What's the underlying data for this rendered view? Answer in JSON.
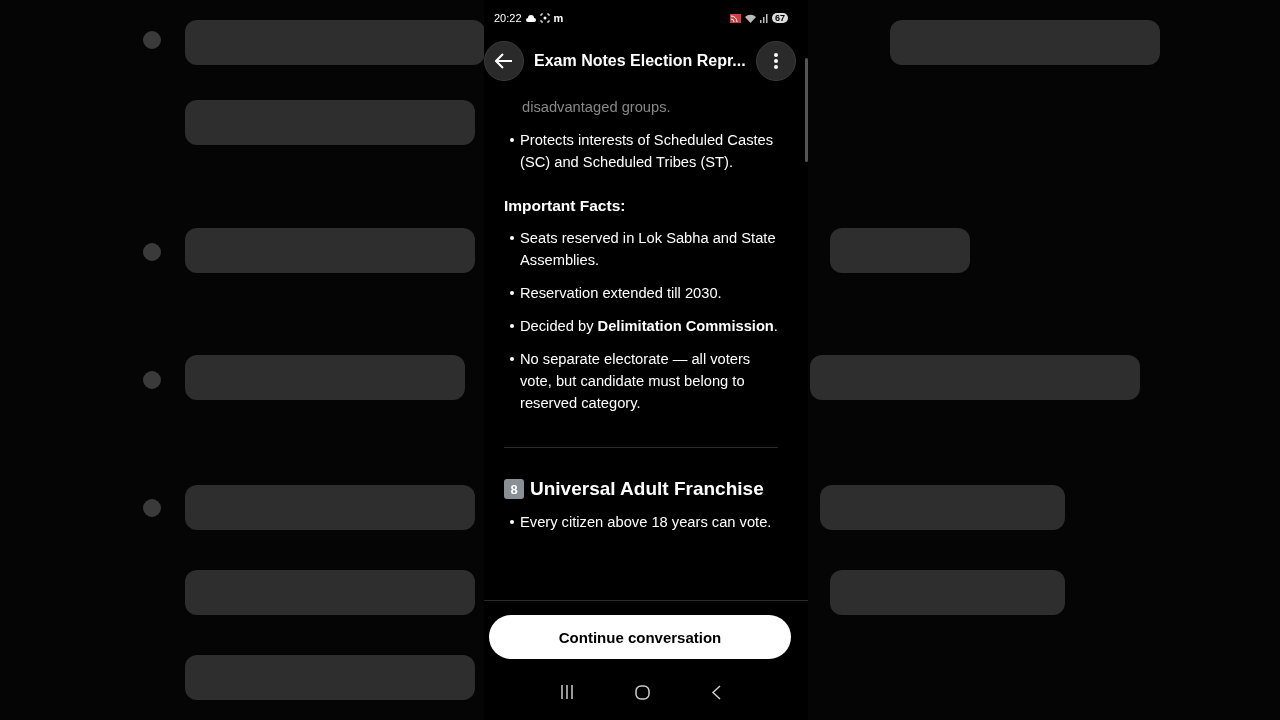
{
  "status_bar": {
    "time": "20:22",
    "app_letter": "m",
    "battery": "67"
  },
  "header": {
    "title": "Exam Notes Election Repr..."
  },
  "content": [
    {
      "kind": "faded",
      "text": "disadvantaged groups."
    },
    {
      "kind": "bullets",
      "items": [
        "Protects interests of Scheduled Castes (SC) and Scheduled Tribes (ST)."
      ]
    },
    {
      "kind": "heading",
      "text": "Important Facts:"
    },
    {
      "kind": "bullets",
      "items": [
        "Seats reserved in Lok Sabha and State Assemblies.",
        "Reservation extended till 2030.",
        "Decided by **Delimitation Commission**.",
        "No separate electorate — all voters vote, but candidate must belong to reserved category."
      ]
    },
    {
      "kind": "divider"
    },
    {
      "kind": "section",
      "number": "8",
      "text": "Universal Adult Franchise"
    },
    {
      "kind": "bullets",
      "items": [
        "Every citizen above 18 years can vote."
      ]
    }
  ],
  "button": {
    "label": "Continue conversation"
  }
}
